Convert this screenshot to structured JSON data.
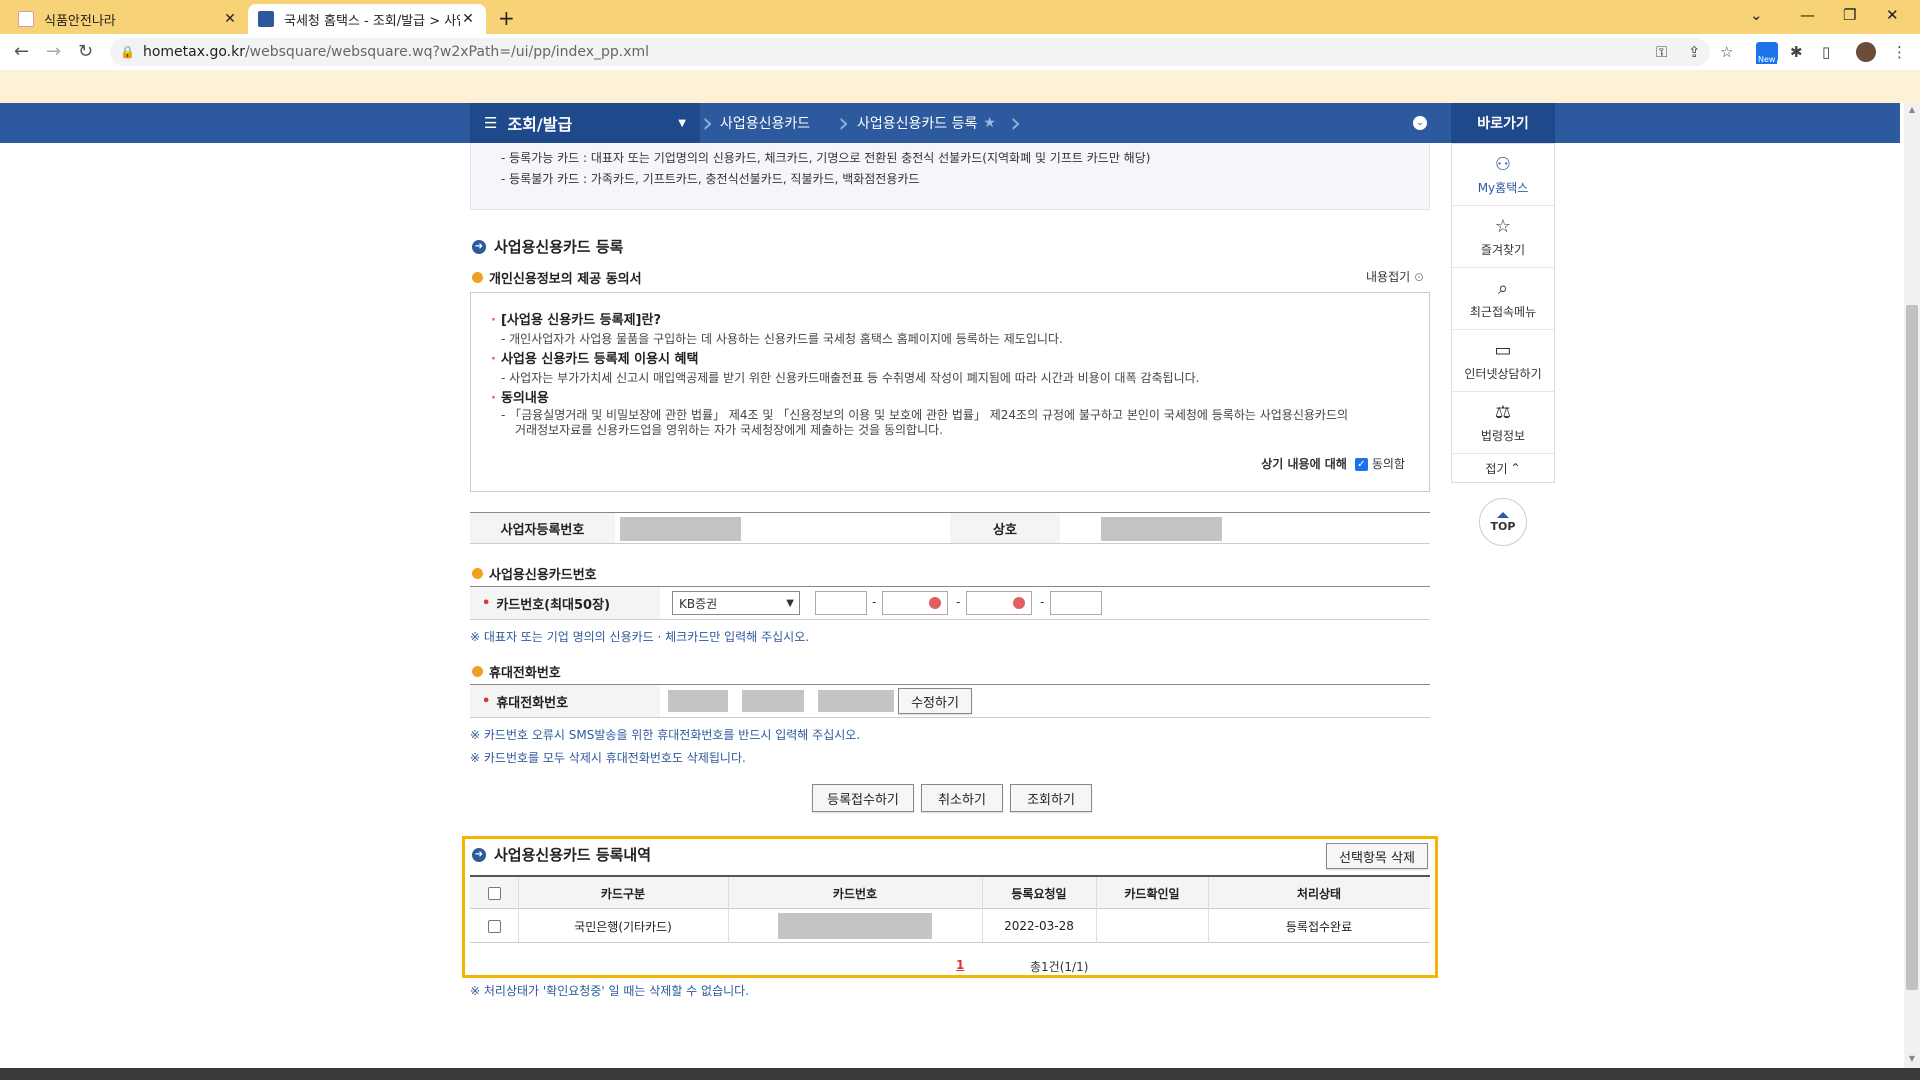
{
  "browser": {
    "tabs": [
      {
        "title": "식품안전나라",
        "active": false
      },
      {
        "title": "국세청 홈택스 - 조회/발급 > 사업용신용카드",
        "active": true
      }
    ],
    "url_host": "hometax.go.kr",
    "url_path": "/websquare/websquare.wq?w2xPath=/ui/pp/index_pp.xml",
    "ext_badge": "New"
  },
  "header": {
    "menu": "조회/발급",
    "crumb1": "사업용신용카드",
    "crumb2": "사업용신용카드 등록",
    "goto": "바로가기"
  },
  "quick_menu": {
    "items": [
      "My홈택스",
      "즐겨찾기",
      "최근접속메뉴",
      "인터넷상담하기",
      "법령정보"
    ],
    "fold": "접기",
    "top": "TOP"
  },
  "notice": {
    "line1": "- 등록가능 카드 : 대표자 또는 기업명의의 신용카드, 체크카드, 기명으로 전환된 충전식 선불카드(지역화폐 및 기프트 카드만 해당)",
    "line2": "- 등록불가 카드 : 가족카드, 기프트카드, 충전식선불카드, 직불카드, 백화점전용카드"
  },
  "register": {
    "title": "사업용신용카드 등록",
    "consent_title": "개인신용정보의 제공 동의서",
    "fold": "내용접기",
    "h1": "[사업용 신용카드 등록제]란?",
    "b1": "- 개인사업자가 사업용 물품을 구입하는 데 사용하는 신용카드를 국세청 홈택스 홈페이지에 등록하는 제도입니다.",
    "h2": "사업용 신용카드 등록제 이용시 혜택",
    "b2": "- 사업자는 부가가치세 신고시 매입액공제를 받기 위한 신용카드매출전표 등 수취명세 작성이 폐지됨에 따라 시간과 비용이 대폭 감축됩니다.",
    "h3": "동의내용",
    "b3a": "- 「금융실명거래 및 비밀보장에 관한 법률」 제4조 및 「신용정보의 이용 및 보호에 관한 법률」 제24조의 규정에 불구하고 본인이 국세청에 등록하는 사업용신용카드의",
    "b3b": "거래정보자료를 신용카드업을 영위하는 자가 국세청장에게 제출하는 것을 동의합니다.",
    "agree_label": "상기 내용에 대해",
    "agree_check": "동의함",
    "biz_no_label": "사업자등록번호",
    "company_label": "상호"
  },
  "card": {
    "title": "사업용신용카드번호",
    "label": "카드번호(최대50장)",
    "bank": "KB증권",
    "note": "※ 대표자 또는 기업 명의의 신용카드 · 체크카드만 입력해 주십시오."
  },
  "phone": {
    "title": "휴대전화번호",
    "label": "휴대전화번호",
    "edit": "수정하기",
    "note1": "※ 카드번호 오류시 SMS발송을 위한 휴대전화번호를 반드시 입력해 주십시오.",
    "note2": "※ 카드번호를 모두 삭제시 휴대전화번호도 삭제됩니다."
  },
  "actions": {
    "submit": "등록접수하기",
    "cancel": "취소하기",
    "search": "조회하기"
  },
  "history": {
    "title": "사업용신용카드 등록내역",
    "delete": "선택항목 삭제",
    "columns": [
      "카드구분",
      "카드번호",
      "등록요청일",
      "카드확인일",
      "처리상태"
    ],
    "rows": [
      {
        "type": "국민은행(기타카드)",
        "request_date": "2022-03-28",
        "confirm_date": "",
        "status": "등록접수완료"
      }
    ],
    "page": "1",
    "total": "총1건(1/1)",
    "note": "※ 처리상태가 '확인요청중' 일 때는 삭제할 수 없습니다."
  }
}
